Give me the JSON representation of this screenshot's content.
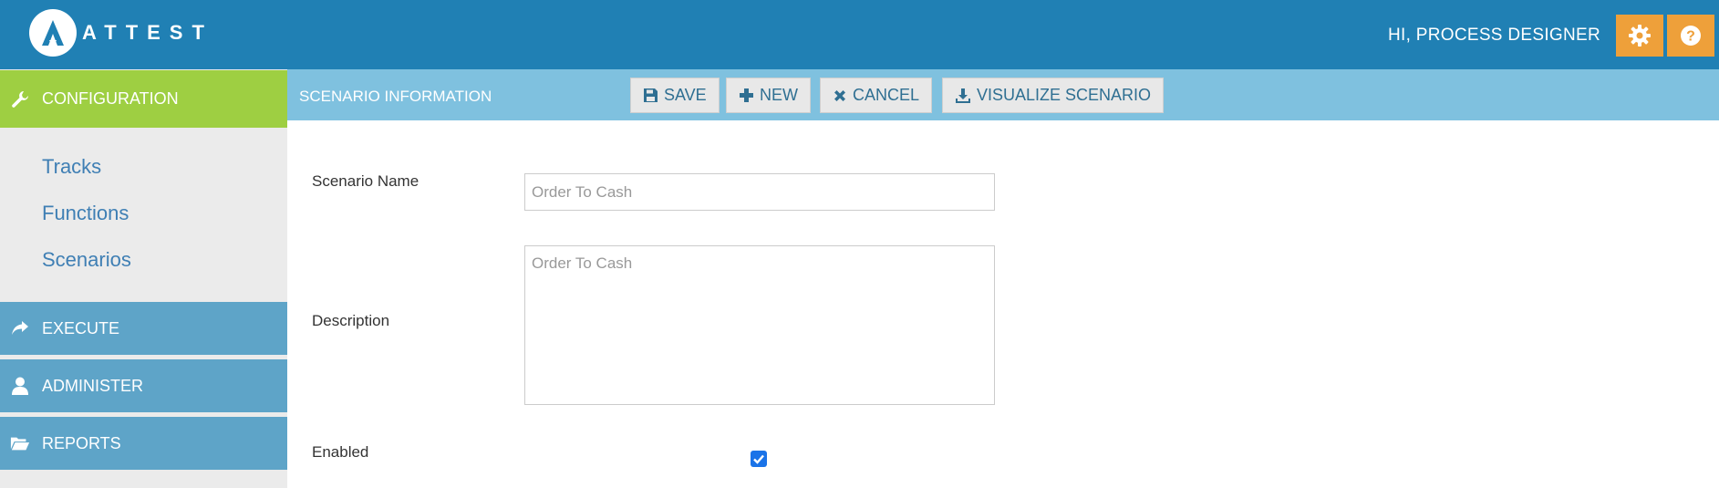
{
  "header": {
    "logo_text": "ATTEST",
    "greeting": "HI, PROCESS DESIGNER",
    "settings_icon": "gear-icon",
    "help_icon": "question-circle-icon"
  },
  "sidebar": {
    "configuration": "CONFIGURATION",
    "links": [
      "Tracks",
      "Functions",
      "Scenarios"
    ],
    "execute": "EXECUTE",
    "administer": "ADMINISTER",
    "reports": "REPORTS"
  },
  "toolbar": {
    "title": "SCENARIO INFORMATION",
    "save": "SAVE",
    "new": "NEW",
    "cancel": "CANCEL",
    "visualize": "VISUALIZE SCENARIO"
  },
  "form": {
    "name_label": "Scenario Name",
    "name_value": "Order To Cash",
    "description_label": "Description",
    "description_value": "Order To Cash",
    "enabled_label": "Enabled",
    "enabled": true
  },
  "colors": {
    "header": "#2080b4",
    "accent_orange": "#eea03a",
    "config_green": "#9ecf42",
    "nav_blue": "#5ea4c8",
    "toolbar_blue": "#7fc1df"
  }
}
